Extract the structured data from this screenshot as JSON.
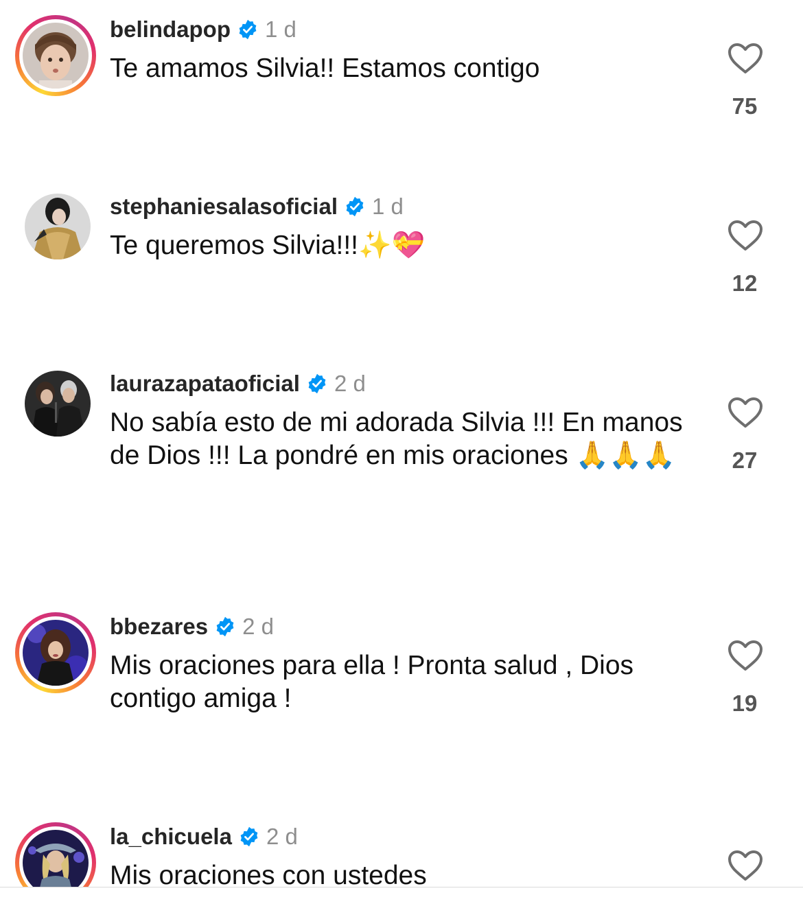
{
  "comments": [
    {
      "username": "belindapop",
      "time": "1 d",
      "text": "Te amamos Silvia!! Estamos contigo",
      "likes": "75",
      "has_story": true,
      "avatar_icon": "child-portrait-avatar"
    },
    {
      "username": "stephaniesalasoficial",
      "time": "1 d",
      "text": "Te queremos Silvia!!!✨💝",
      "likes": "12",
      "has_story": false,
      "avatar_icon": "gold-outfit-portrait-avatar"
    },
    {
      "username": "laurazapataoficial",
      "time": "2 d",
      "text": "No sabía esto de mi adorada Silvia !!! En manos de Dios !!! La pondré en mis oraciones 🙏🙏🙏",
      "likes": "27",
      "has_story": false,
      "avatar_icon": "couple-portrait-avatar"
    },
    {
      "username": "bbezares",
      "time": "2 d",
      "text": "Mis oraciones para ella ! Pronta salud , Dios contigo amiga !",
      "likes": "19",
      "has_story": true,
      "avatar_icon": "singer-stage-avatar"
    },
    {
      "username": "la_chicuela",
      "time": "2 d",
      "text": "Mis oraciones con ustedes",
      "likes": "",
      "has_story": true,
      "avatar_icon": "hat-portrait-avatar"
    }
  ],
  "colors": {
    "verified_badge": "#0095f6",
    "username": "#262626",
    "timestamp": "#8e8e8e",
    "like_count": "#555555",
    "story_ring": [
      "#fdd835",
      "#f77737",
      "#e1306c",
      "#c13584"
    ]
  }
}
